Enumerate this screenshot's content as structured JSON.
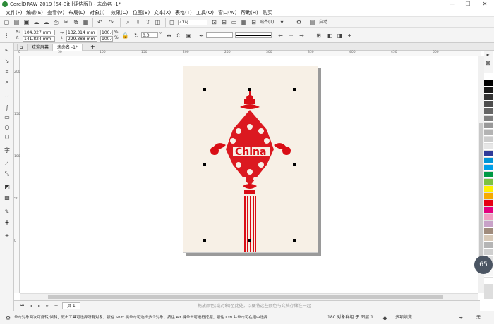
{
  "window": {
    "title": "CorelDRAW 2019 (64-Bit [评估版]) - 未命名 -1*",
    "minimize": "—",
    "maximize": "☐",
    "close": "✕"
  },
  "menu": [
    "文件(F)",
    "编辑(E)",
    "查看(V)",
    "布局(L)",
    "对象(J)",
    "效果(C)",
    "位图(B)",
    "文本(X)",
    "表格(T)",
    "工具(O)",
    "窗口(W)",
    "帮助(H)",
    "购买"
  ],
  "toolbar": {
    "zoom": "47%",
    "snap": "贴齐(T)",
    "launch": "启动"
  },
  "props": {
    "x_label": "X:",
    "y_label": "Y:",
    "x": "104.327 mm",
    "y": "141.824 mm",
    "w": "132.314 mm",
    "h": "229.388 mm",
    "sx": "100.0",
    "sy": "100.0",
    "pct": "%",
    "angle": "0.0",
    "angle_unit": "°"
  },
  "tabs": {
    "welcome": "欢迎屏幕",
    "doc": "未命名 -1*",
    "add": "+"
  },
  "ruler_top": [
    "0",
    "50",
    "100",
    "150",
    "200",
    "250",
    "300",
    "350",
    "400",
    "450",
    "500"
  ],
  "ruler_left": [
    "200",
    "150",
    "100",
    "50",
    "0"
  ],
  "art": {
    "text": "China",
    "color": "#d90d15"
  },
  "pagebar": {
    "page_tab": "页 1",
    "hint": "拖放颜色(或对象)至此处，以便将这些颜色与文档存储在一起"
  },
  "status": {
    "hint": "单击对象两次可旋转/倾斜；双击工具可选择所有对象；按住 Shift 键单击可选择多个对象；按住 Alt 键单击可进行挖掘；按住 Ctrl 并单击可在组中选择",
    "selection": "180 对象群组 于 图层 1",
    "fill": "多项填充",
    "outline": "无"
  },
  "zoom_bubble": "65",
  "palette": [
    "#ffffff",
    "#000000",
    "#1a1a1a",
    "#333333",
    "#4d4d4d",
    "#666666",
    "#808080",
    "#999999",
    "#b3b3b3",
    "#cccccc",
    "#e6e6e6",
    "#2f3a98",
    "#0096d6",
    "#00a0e9",
    "#009944",
    "#7cc242",
    "#fff100",
    "#f7ab00",
    "#e60012",
    "#e4007f",
    "#f19ec2",
    "#c8a2c8",
    "#a08c7d",
    "#d7c9b8",
    "#b5b5b5",
    "#cfcfcf",
    "#e0e0e0",
    "#efefef",
    "#f7f7f7",
    "#ffffff"
  ]
}
